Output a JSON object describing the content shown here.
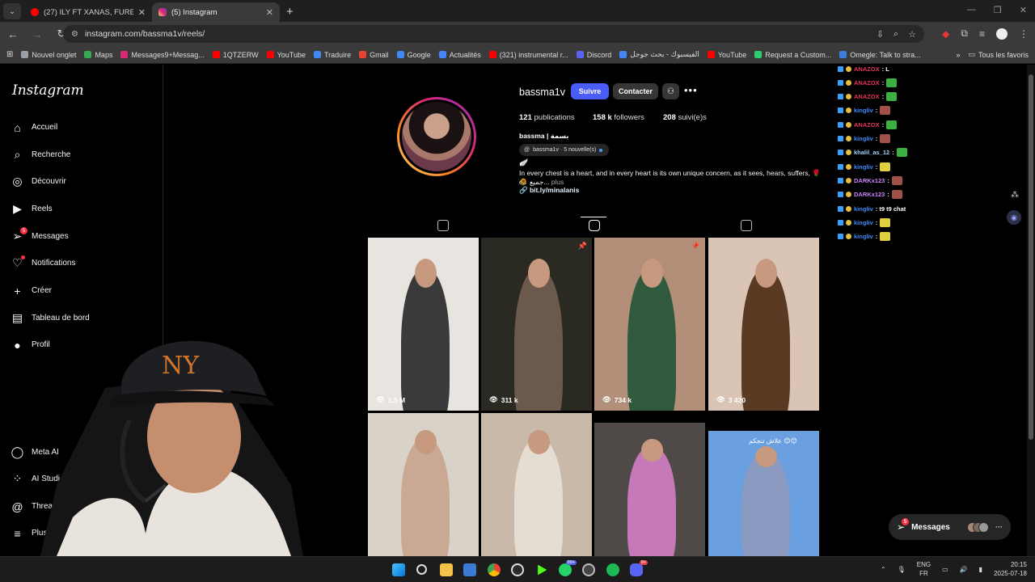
{
  "browser": {
    "tabs": [
      {
        "title": "(27) ILY FT XANAS, FURELISE - S",
        "type": "youtube"
      },
      {
        "title": "(5) Instagram",
        "type": "instagram",
        "active": true
      }
    ],
    "url": "instagram.com/bassma1v/reels/",
    "bookmarks": [
      {
        "label": "Nouvel onglet",
        "color": "#9aa0a6"
      },
      {
        "label": "Maps",
        "color": "#34a853"
      },
      {
        "label": "Messages9+Messag...",
        "color": "#d62976"
      },
      {
        "label": "1QTZERW",
        "color": "#ff0000"
      },
      {
        "label": "YouTube",
        "color": "#ff0000"
      },
      {
        "label": "Traduire",
        "color": "#4285f4"
      },
      {
        "label": "Gmail",
        "color": "#ea4335"
      },
      {
        "label": "Google",
        "color": "#4285f4"
      },
      {
        "label": "Actualités",
        "color": "#4285f4"
      },
      {
        "label": "(321) instrumental r...",
        "color": "#ff0000"
      },
      {
        "label": "Discord",
        "color": "#5865f2"
      },
      {
        "label": "الفيسبوك - بحث جوجل",
        "color": "#4285f4"
      },
      {
        "label": "YouTube",
        "color": "#ff0000"
      },
      {
        "label": "Request a Custom...",
        "color": "#2ecc71"
      },
      {
        "label": "Omegle: Talk to stra...",
        "color": "#3b7ddd"
      }
    ],
    "bookmarks_all": "Tous les favoris"
  },
  "sidebar": {
    "logo": "Instagram",
    "items": [
      {
        "label": "Accueil",
        "icon": "⌂",
        "name": "home-icon"
      },
      {
        "label": "Recherche",
        "icon": "⌕",
        "name": "search-icon"
      },
      {
        "label": "Découvrir",
        "icon": "◎",
        "name": "compass-icon"
      },
      {
        "label": "Reels",
        "icon": "▶",
        "name": "reels-icon"
      },
      {
        "label": "Messages",
        "icon": "➢",
        "name": "messages-icon",
        "badge": "5"
      },
      {
        "label": "Notifications",
        "icon": "♡",
        "name": "heart-icon",
        "dot": true
      },
      {
        "label": "Créer",
        "icon": "+",
        "name": "plus-icon"
      },
      {
        "label": "Tableau de bord",
        "icon": "▤",
        "name": "dashboard-icon"
      },
      {
        "label": "Profil",
        "icon": "●",
        "name": "profile-icon"
      },
      {
        "label": "Meta AI",
        "icon": "◯",
        "name": "meta-ai-icon"
      },
      {
        "label": "AI Studio",
        "icon": "⁘",
        "name": "ai-studio-icon"
      },
      {
        "label": "Threads",
        "icon": "@",
        "name": "threads-icon"
      },
      {
        "label": "Plus",
        "icon": "≡",
        "name": "menu-icon"
      }
    ]
  },
  "profile": {
    "username": "bassma1v",
    "follow_label": "Suivre",
    "contact_label": "Contacter",
    "stats": {
      "posts_count": "121",
      "posts_label": "publications",
      "followers_count": "158 k",
      "followers_label": "followers",
      "following_count": "208",
      "following_label": "suivi(e)s"
    },
    "display_name": "bassma | بسمة",
    "threads_badge": "bassma1v · 5 nouvelle(s)",
    "bio_emoji": "🪽",
    "bio": "In every chest is a heart, and in every heart is its own unique concern, as it sees, hears, suffers, 🌹  es",
    "bio_line2": "🌻 جميع...",
    "bio_more": "plus",
    "link": "bit.ly/minalanis"
  },
  "reels": [
    {
      "views": "1,5 M",
      "pinned": false,
      "bg": "#e8e4df",
      "fig": "#3a3a3a"
    },
    {
      "views": "311 k",
      "pinned": true,
      "bg": "#2b2a22",
      "fig": "#6b5a4c"
    },
    {
      "views": "734 k",
      "pinned": true,
      "bg": "#b38f7a",
      "fig": "#2f5a3e"
    },
    {
      "views": "3 420",
      "pinned": false,
      "bg": "#d9c4b5",
      "fig": "#5b3a24"
    },
    {
      "views": "",
      "pinned": false,
      "bg": "#d8d2c8",
      "fig": "#c9a894"
    },
    {
      "views": "",
      "pinned": false,
      "bg": "#c8b9a9",
      "fig": "#e6ddd2"
    },
    {
      "views": "",
      "pinned": false,
      "bg": "#4f4a47",
      "fig": "#c579b8"
    },
    {
      "views": "",
      "pinned": false,
      "bg": "#6aa0e0",
      "fig": "#8a9ac0",
      "caption": "علاش تنجكم 😊😊"
    }
  ],
  "chat": [
    {
      "user": "ANAZOX",
      "msg": ": L",
      "color": "#e8345a",
      "emote": ""
    },
    {
      "user": "ANAZOX",
      "msg": ":",
      "color": "#e8345a",
      "emote": "#3cb043"
    },
    {
      "user": "ANAZOX",
      "msg": ":",
      "color": "#e8345a",
      "emote": "#3cb043"
    },
    {
      "user": "kingliv",
      "msg": ":",
      "color": "#3d8bff",
      "emote": "#a0524a"
    },
    {
      "user": "ANAZOX",
      "msg": ":",
      "color": "#e8345a",
      "emote": "#3cb043"
    },
    {
      "user": "kingliv",
      "msg": ":",
      "color": "#3d8bff",
      "emote": "#a0524a"
    },
    {
      "user": "khalil_as_12",
      "msg": ":",
      "color": "#9ad4ff",
      "emote": "#3cb043"
    },
    {
      "user": "kingliv",
      "msg": ":",
      "color": "#3d8bff",
      "emote": "#e0d040"
    },
    {
      "user": "DARKx123",
      "msg": ":",
      "color": "#c985ff",
      "emote": "#a0524a"
    },
    {
      "user": "DARKx123",
      "msg": ":",
      "color": "#c985ff",
      "emote": "#a0524a"
    },
    {
      "user": "kingliv",
      "msg": ": t9 t9 chat",
      "color": "#3d8bff",
      "emote": ""
    },
    {
      "user": "kingliv",
      "msg": ":",
      "color": "#3d8bff",
      "emote": "#e0d040"
    },
    {
      "user": "kingliv",
      "msg": ":",
      "color": "#3d8bff",
      "emote": "#e0d040"
    }
  ],
  "messages_float": {
    "label": "Messages",
    "badge": "5"
  },
  "taskbar": {
    "lang_top": "ENG",
    "lang_bottom": "FR",
    "time": "20:15",
    "date": "2025-07-18",
    "whatsapp_badge": "99+",
    "discord_badge": "9+"
  }
}
